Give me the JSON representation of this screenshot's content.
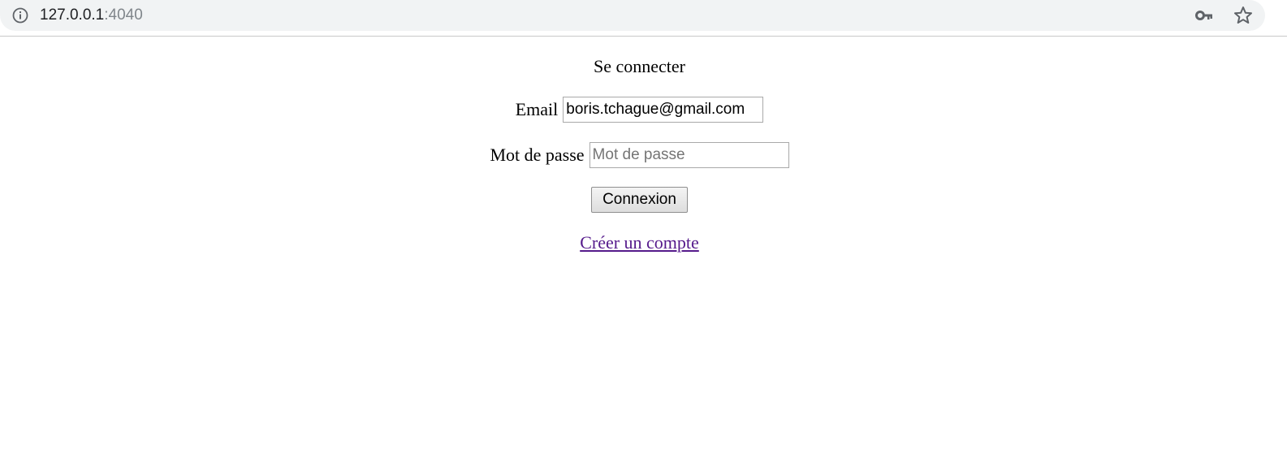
{
  "browser": {
    "url_host": "127.0.0.1",
    "url_port": ":4040",
    "icons": {
      "info": "info-icon",
      "key": "key-icon",
      "star": "star-icon"
    }
  },
  "form": {
    "title": "Se connecter",
    "email_label": "Email",
    "email_value": "boris.tchague@gmail.com",
    "password_label": "Mot de passe",
    "password_placeholder": "Mot de passe",
    "password_value": "",
    "submit_label": "Connexion",
    "register_link": "Créer un compte"
  },
  "colors": {
    "visited_link": "#551a8b",
    "addressbar_bg": "#f1f3f4"
  }
}
